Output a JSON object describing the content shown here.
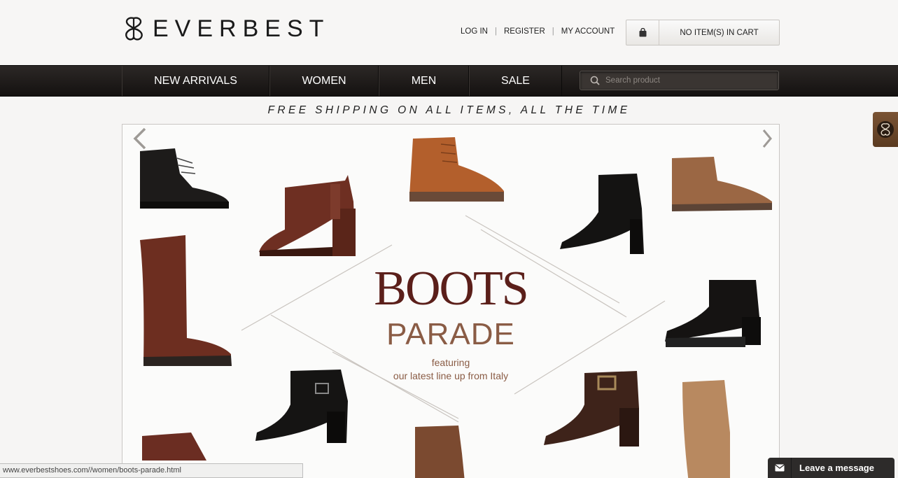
{
  "header": {
    "brand": "EVERBEST",
    "links": [
      {
        "label": "LOG IN"
      },
      {
        "label": "REGISTER"
      },
      {
        "label": "MY ACCOUNT"
      }
    ],
    "separator": "|",
    "cart_label": "NO ITEM(S) IN CART",
    "cart_icon": "shopping-bag-icon"
  },
  "nav": {
    "items": [
      {
        "label": "NEW ARRIVALS"
      },
      {
        "label": "WOMEN"
      },
      {
        "label": "MEN"
      },
      {
        "label": "SALE"
      }
    ],
    "search_placeholder": "Search product",
    "search_icon": "search-icon"
  },
  "promo": "FREE SHIPPING ON ALL ITEMS, ALL THE TIME",
  "banner": {
    "title": "BOOTS",
    "subtitle": "PARADE",
    "featuring": "featuring",
    "tagline": "our latest line up from Italy",
    "colors": {
      "title": "#5b1f1a",
      "subtitle": "#8a5c45"
    }
  },
  "status_url": "www.everbestshoes.com//women/boots-parade.html",
  "chat": {
    "label": "Leave a message",
    "icon": "envelope-icon"
  },
  "colors": {
    "nav_bg": "#1c1917",
    "accent_brown": "#6b4528"
  }
}
